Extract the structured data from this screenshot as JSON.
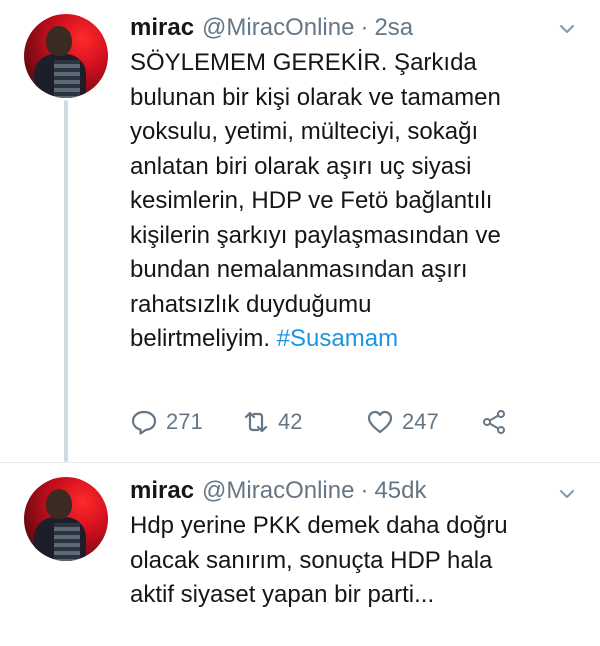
{
  "tweets": [
    {
      "name": "mirac",
      "handle": "@MiracOnline",
      "separator": "·",
      "time": "2sa",
      "lines": [
        "SÖYLEMEM GEREKİR. Şarkıda",
        "bulunan bir kişi olarak ve tamamen",
        "yoksulu, yetimi, mülteciyi, sokağı",
        "anlatan biri olarak aşırı uç siyasi",
        "kesimlerin, HDP ve Fetö bağlantılı",
        "kişilerin şarkıyı paylaşmasından ve",
        "bundan nemalanmasından aşırı",
        "rahatsızlık duyduğumu"
      ],
      "last_line_text": "belirtmeliyim.",
      "hashtag": "#Susamam",
      "actions": {
        "reply_count": "271",
        "retweet_count": "42",
        "like_count": "247"
      }
    },
    {
      "name": "mirac",
      "handle": "@MiracOnline",
      "separator": "·",
      "time": "45dk",
      "lines": [
        "Hdp yerine PKK demek daha doğru",
        "olacak sanırım, sonuçta HDP hala",
        "aktif siyaset yapan bir parti..."
      ]
    }
  ],
  "colors": {
    "text": "#14171a",
    "secondary": "#657786",
    "link": "#1b95e0",
    "thread_line": "#cfd9de"
  },
  "icons": [
    "reply-icon",
    "retweet-icon",
    "like-icon",
    "share-icon",
    "chevron-down-icon"
  ]
}
